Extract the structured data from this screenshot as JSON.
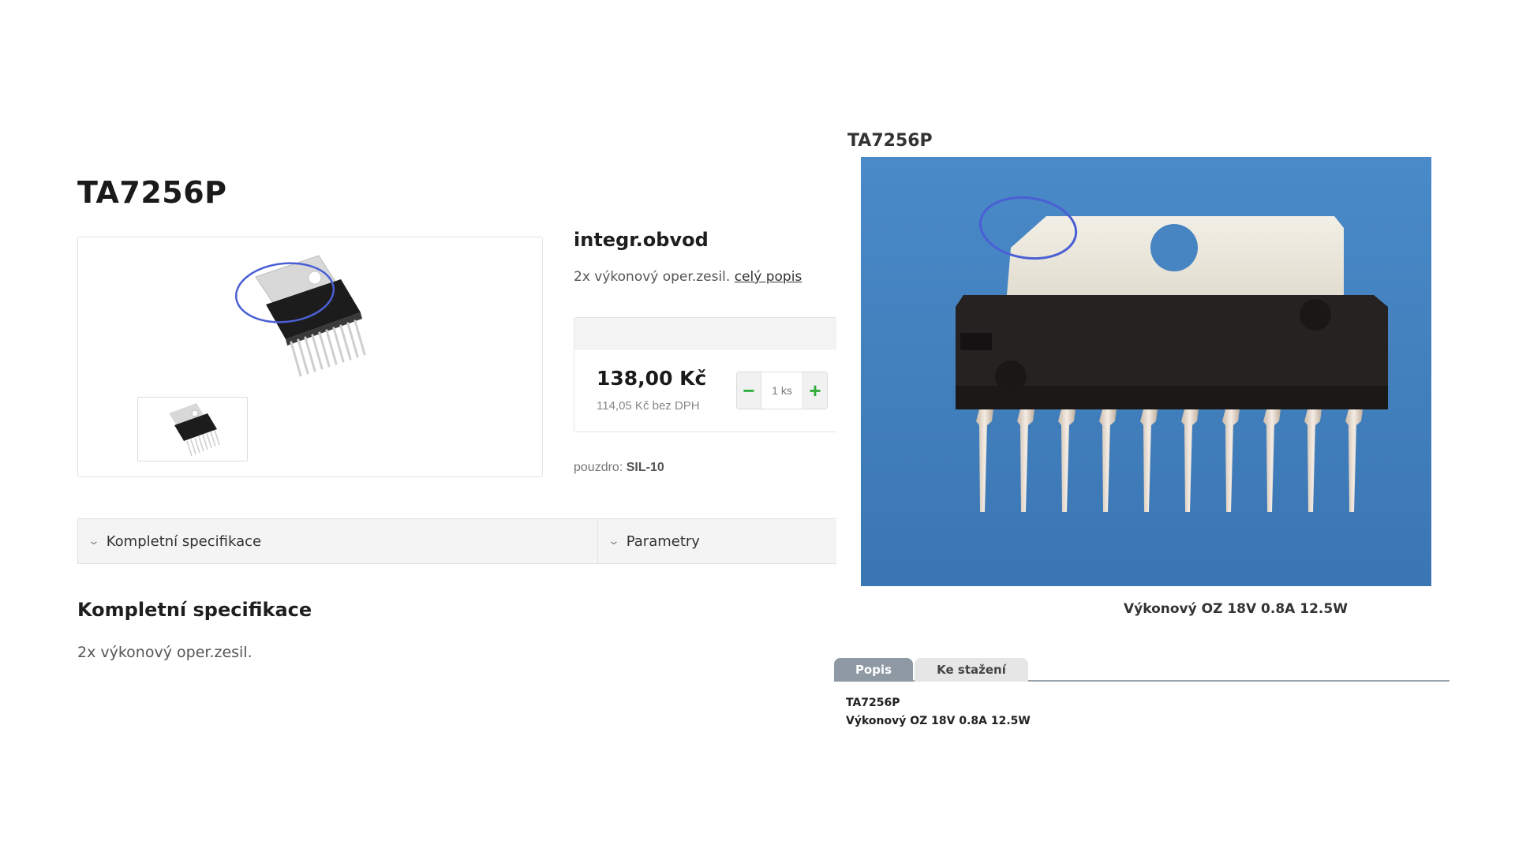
{
  "shop": {
    "title": "TA7256P",
    "subtitle": "integr.obvod",
    "short_description": "2x výkonový oper.zesil.",
    "full_description_link": "celý popis",
    "price": "138,00 Kč",
    "price_without_vat": "114,05 Kč bez DPH",
    "quantity_minus": "−",
    "quantity_value": "1 ks",
    "quantity_plus": "+",
    "package_label": "pouzdro:",
    "package_value": "SIL-10",
    "tabs": [
      "Kompletní specifikace",
      "Parametry"
    ],
    "spec_heading": "Kompletní specifikace",
    "spec_text": "2x výkonový oper.zesil."
  },
  "catalog": {
    "title": "TA7256P",
    "caption": "Výkonový OZ 18V 0.8A 12.5W",
    "tabs": [
      "Popis",
      "Ke stažení"
    ],
    "description_title": "TA7256P",
    "description_text": "Výkonový OZ 18V 0.8A 12.5W"
  },
  "colors": {
    "accent_green": "#2fae3b",
    "annotation_blue": "#4a5fd4",
    "photo_background": "#3f80bf",
    "active_tab": "#8e99a4"
  },
  "icons": [
    "chevron-down-icon",
    "minus-icon",
    "plus-icon"
  ]
}
